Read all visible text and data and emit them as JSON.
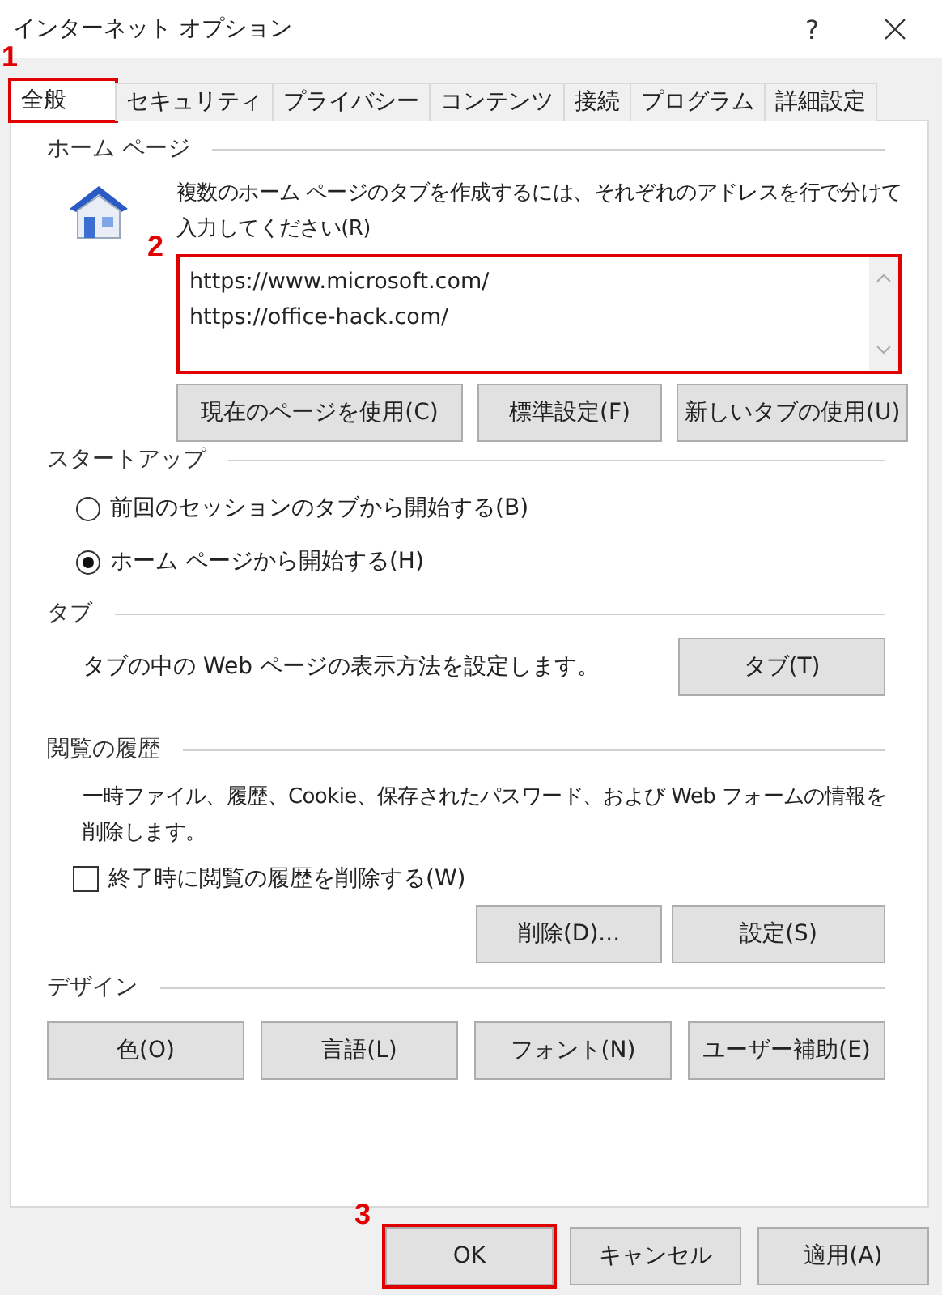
{
  "window": {
    "title": "インターネット オプション",
    "help": "?"
  },
  "tabs": [
    {
      "label": "全般",
      "selected": true,
      "callout": "1"
    },
    {
      "label": "セキュリティ",
      "selected": false
    },
    {
      "label": "プライバシー",
      "selected": false
    },
    {
      "label": "コンテンツ",
      "selected": false
    },
    {
      "label": "接続",
      "selected": false
    },
    {
      "label": "プログラム",
      "selected": false
    },
    {
      "label": "詳細設定",
      "selected": false
    }
  ],
  "home_page": {
    "heading": "ホーム ページ",
    "description": "複数のホーム ページのタブを作成するには、それぞれのアドレスを行で分けて入力してください(R)",
    "urls": [
      "https://www.microsoft.com/",
      "https://office-hack.com/"
    ],
    "callout": "2",
    "buttons": [
      "現在のページを使用(C)",
      "標準設定(F)",
      "新しいタブの使用(U)"
    ]
  },
  "startup": {
    "heading": "スタートアップ",
    "options": [
      {
        "label": "前回のセッションのタブから開始する(B)",
        "selected": false
      },
      {
        "label": "ホーム ページから開始する(H)",
        "selected": true
      }
    ]
  },
  "tabs_section": {
    "heading": "タブ",
    "description": "タブの中の Web ページの表示方法を設定します。",
    "button": "タブ(T)"
  },
  "history": {
    "heading": "閲覧の履歴",
    "description": "一時ファイル、履歴、Cookie、保存されたパスワード、および Web フォームの情報を削除します。",
    "checkbox": {
      "label": "終了時に閲覧の履歴を削除する(W)",
      "checked": false
    },
    "buttons": [
      "削除(D)...",
      "設定(S)"
    ]
  },
  "design": {
    "heading": "デザイン",
    "buttons": [
      "色(O)",
      "言語(L)",
      "フォント(N)",
      "ユーザー補助(E)"
    ]
  },
  "footer_buttons": [
    {
      "label": "OK",
      "callout": "3"
    },
    {
      "label": "キャンセル"
    },
    {
      "label": "適用(A)"
    }
  ]
}
